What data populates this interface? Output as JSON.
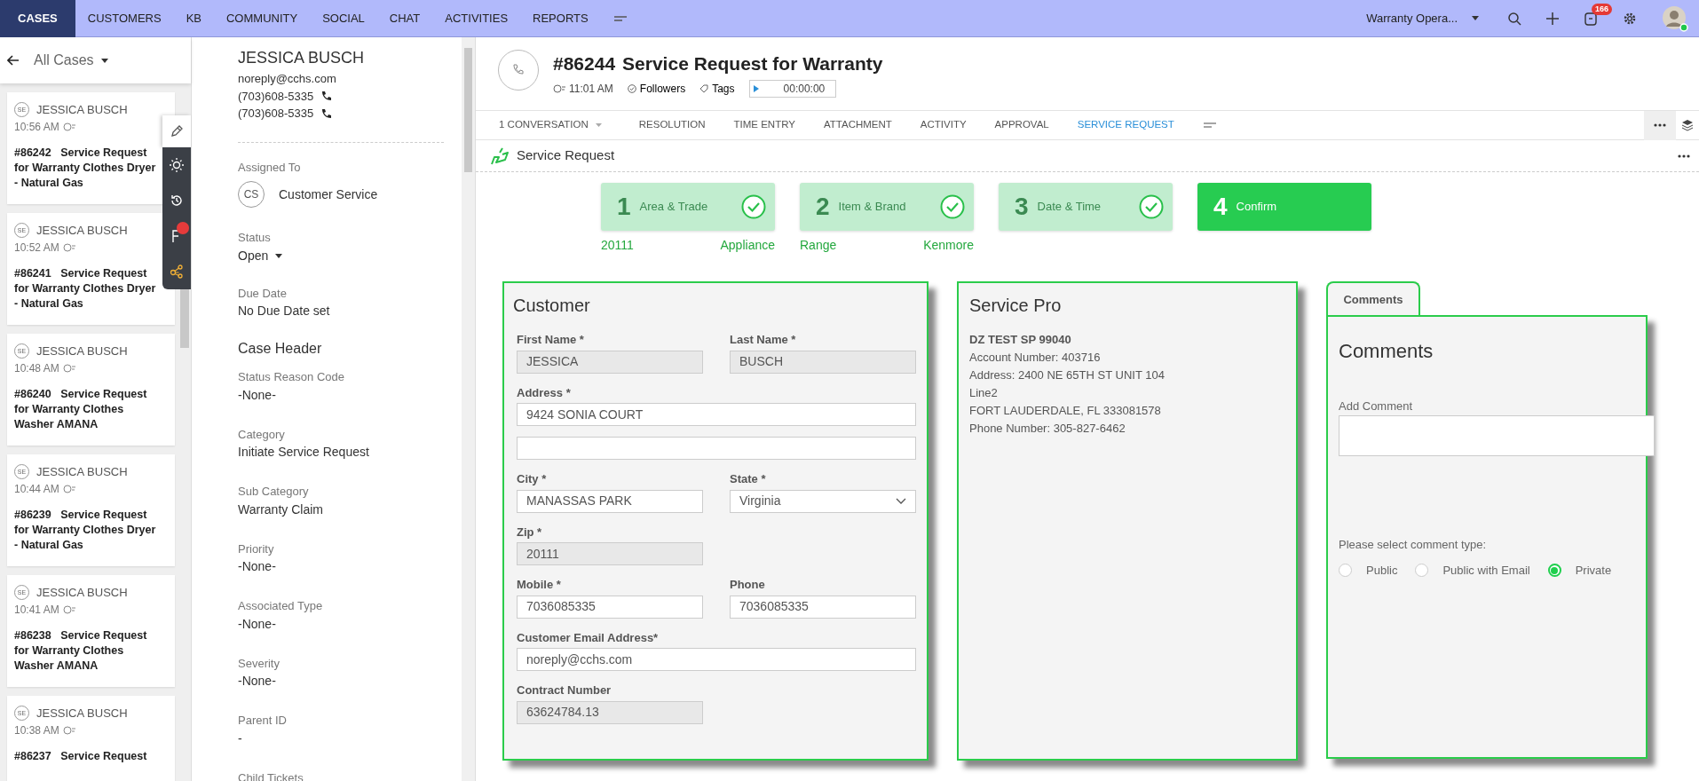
{
  "top_nav": {
    "items": [
      {
        "label": "CASES",
        "selected": true
      },
      {
        "label": "CUSTOMERS",
        "selected": false
      },
      {
        "label": "KB",
        "selected": false
      },
      {
        "label": "COMMUNITY",
        "selected": false
      },
      {
        "label": "SOCIAL",
        "selected": false
      },
      {
        "label": "CHAT",
        "selected": false
      },
      {
        "label": "ACTIVITIES",
        "selected": false
      },
      {
        "label": "REPORTS",
        "selected": false
      }
    ],
    "workspace": "Warranty Opera...",
    "notification_count": "166"
  },
  "case_list": {
    "view": "All Cases",
    "cases": [
      {
        "initials": "SE",
        "name": "JESSICA BUSCH",
        "time": "10:56 AM",
        "number": "#86242",
        "subject": "Service Request for Warranty Clothes Dryer - Natural Gas"
      },
      {
        "initials": "SE",
        "name": "JESSICA BUSCH",
        "time": "10:52 AM",
        "number": "#86241",
        "subject": "Service Request for Warranty Clothes Dryer - Natural Gas"
      },
      {
        "initials": "SE",
        "name": "JESSICA BUSCH",
        "time": "10:48 AM",
        "number": "#86240",
        "subject": "Service Request for Warranty Clothes Washer AMANA"
      },
      {
        "initials": "SE",
        "name": "JESSICA BUSCH",
        "time": "10:44 AM",
        "number": "#86239",
        "subject": "Service Request for Warranty Clothes Dryer - Natural Gas"
      },
      {
        "initials": "SE",
        "name": "JESSICA BUSCH",
        "time": "10:41 AM",
        "number": "#86238",
        "subject": "Service Request for Warranty Clothes Washer AMANA"
      },
      {
        "initials": "SE",
        "name": "JESSICA BUSCH",
        "time": "10:38 AM",
        "number": "#86237",
        "subject": "Service Request"
      }
    ]
  },
  "contact": {
    "name": "JESSICA BUSCH",
    "email": "noreply@cchs.com",
    "phones": [
      "(703)608-5335",
      "(703)608-5335"
    ]
  },
  "details": {
    "assigned_to": {
      "label": "Assigned To",
      "initials": "CS",
      "value": "Customer Service"
    },
    "status": {
      "label": "Status",
      "value": "Open"
    },
    "due_date": {
      "label": "Due Date",
      "value": "No Due Date set"
    },
    "section": "Case Header",
    "fields": [
      {
        "label": "Status Reason Code",
        "value": "-None-"
      },
      {
        "label": "Category",
        "value": "Initiate Service Request"
      },
      {
        "label": "Sub Category",
        "value": "Warranty Claim"
      },
      {
        "label": "Priority",
        "value": "-None-"
      },
      {
        "label": "Associated Type",
        "value": "-None-"
      },
      {
        "label": "Severity",
        "value": "-None-"
      },
      {
        "label": "Parent ID",
        "value": "-"
      },
      {
        "label": "Child Tickets"
      }
    ]
  },
  "case": {
    "number": "#86244",
    "title": "Service Request for Warranty",
    "time": "11:01 AM",
    "followers": "Followers",
    "tags": "Tags",
    "timer": "00:00:00"
  },
  "tabs": [
    {
      "label": "1 CONVERSATION",
      "selected": false
    },
    {
      "label": "RESOLUTION",
      "selected": false
    },
    {
      "label": "TIME ENTRY",
      "selected": false
    },
    {
      "label": "ATTACHMENT",
      "selected": false
    },
    {
      "label": "ACTIVITY",
      "selected": false
    },
    {
      "label": "APPROVAL",
      "selected": false
    },
    {
      "label": "SERVICE REQUEST",
      "selected": true
    }
  ],
  "section_title": "Service Request",
  "steps": [
    {
      "number": "1",
      "label": "Area & Trade",
      "completed": true,
      "values": [
        "20111",
        "Appliance"
      ]
    },
    {
      "number": "2",
      "label": "Item & Brand",
      "completed": true,
      "values": [
        "Range",
        "Kenmore"
      ]
    },
    {
      "number": "3",
      "label": "Date & Time",
      "completed": true
    },
    {
      "number": "4",
      "label": "Confirm",
      "completed": false
    }
  ],
  "customer": {
    "title": "Customer",
    "rows": [
      [
        {
          "label": "First Name *",
          "value": "JESSICA",
          "disabled": true,
          "kind": "text"
        },
        {
          "label": "Last Name *",
          "value": "BUSCH",
          "disabled": true,
          "kind": "text"
        }
      ],
      [
        {
          "label": "Address *",
          "value": "9424 SONIA COURT",
          "disabled": false,
          "kind": "text"
        }
      ],
      [
        {
          "disabled": false,
          "kind": "text"
        }
      ],
      [
        {
          "label": "City *",
          "value": "MANASSAS PARK",
          "disabled": false,
          "kind": "text"
        },
        {
          "label": "State *",
          "value": "Virginia",
          "disabled": false,
          "kind": "select"
        }
      ],
      [
        {
          "label": "Zip *",
          "value": "20111",
          "disabled": true,
          "kind": "text"
        }
      ],
      [
        {
          "label": "Mobile *",
          "value": "7036085335",
          "disabled": false,
          "kind": "text"
        },
        {
          "label": "Phone",
          "value": "7036085335",
          "disabled": false,
          "kind": "text"
        }
      ],
      [
        {
          "label": "Customer Email Address*",
          "value": "noreply@cchs.com",
          "disabled": false,
          "kind": "text"
        }
      ],
      [
        {
          "label": "Contract Number",
          "value": "63624784.13",
          "disabled": true,
          "kind": "text"
        }
      ]
    ]
  },
  "service_pro": {
    "title": "Service Pro",
    "name": "DZ TEST SP 99040",
    "lines": [
      "Account Number: 403716",
      "Address: 2400 NE 65TH ST UNIT 104",
      "Line2",
      "FORT LAUDERDALE, FL 333081578",
      "Phone Number: 305-827-6462"
    ]
  },
  "comments": {
    "tab": "Comments",
    "title": "Comments",
    "add_label": "Add Comment",
    "prompt": "Please select comment type:",
    "types": [
      {
        "label": "Public",
        "selected": false
      },
      {
        "label": "Public with Email",
        "selected": false
      },
      {
        "label": "Private",
        "selected": true
      }
    ]
  }
}
